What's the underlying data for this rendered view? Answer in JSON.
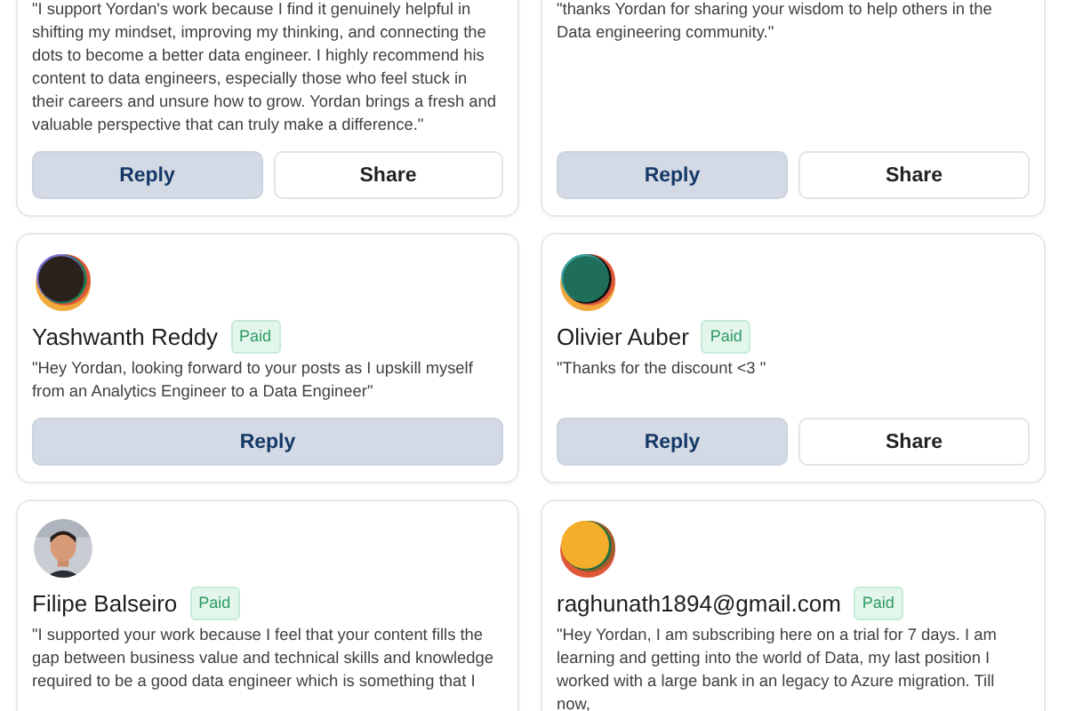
{
  "cards": [
    {
      "quote": "\"I support Yordan's work because I find it genuinely helpful in shifting my mindset, improving my thinking, and connecting the dots to become a better data engineer. I highly recommend his content to data engineers, especially those who feel stuck in their careers and unsure how to grow. Yordan brings a fresh and valuable perspective that can truly make a difference.\"",
      "buttons": [
        {
          "label": "Reply",
          "kind": "reply"
        },
        {
          "label": "Share",
          "kind": "share"
        }
      ]
    },
    {
      "quote": "\"thanks Yordan for sharing your wisdom to help others in the Data engineering community.\"",
      "buttons": [
        {
          "label": "Reply",
          "kind": "reply"
        },
        {
          "label": "Share",
          "kind": "share"
        }
      ]
    },
    {
      "avatar": {
        "kind": "generated"
      },
      "name": "Yashwanth Reddy",
      "badge": "Paid",
      "quote": "\"Hey Yordan, looking forward to your posts as I upskill myself from an Analytics Engineer to a Data Engineer\"",
      "buttons": [
        {
          "label": "Reply",
          "kind": "reply"
        }
      ]
    },
    {
      "avatar": {
        "kind": "generated"
      },
      "name": "Olivier Auber",
      "badge": "Paid",
      "quote": "\"Thanks for the discount <3 \"",
      "buttons": [
        {
          "label": "Reply",
          "kind": "reply"
        },
        {
          "label": "Share",
          "kind": "share"
        }
      ]
    },
    {
      "name": "Filipe Balseiro",
      "badge": "Paid",
      "quote": "\"I supported your work because I feel that your content fills the gap between business value and technical skills and knowledge required to be a good data engineer which is something that I"
    },
    {
      "avatar": {
        "kind": "generated"
      },
      "name": "raghunath1894@gmail.com",
      "badge": "Paid",
      "quote": "\"Hey Yordan, I am subscribing here on a trial for 7 days. I am learning and getting into the world of Data, my last position I worked with a large bank in an legacy to Azure migration. Till now,"
    }
  ]
}
